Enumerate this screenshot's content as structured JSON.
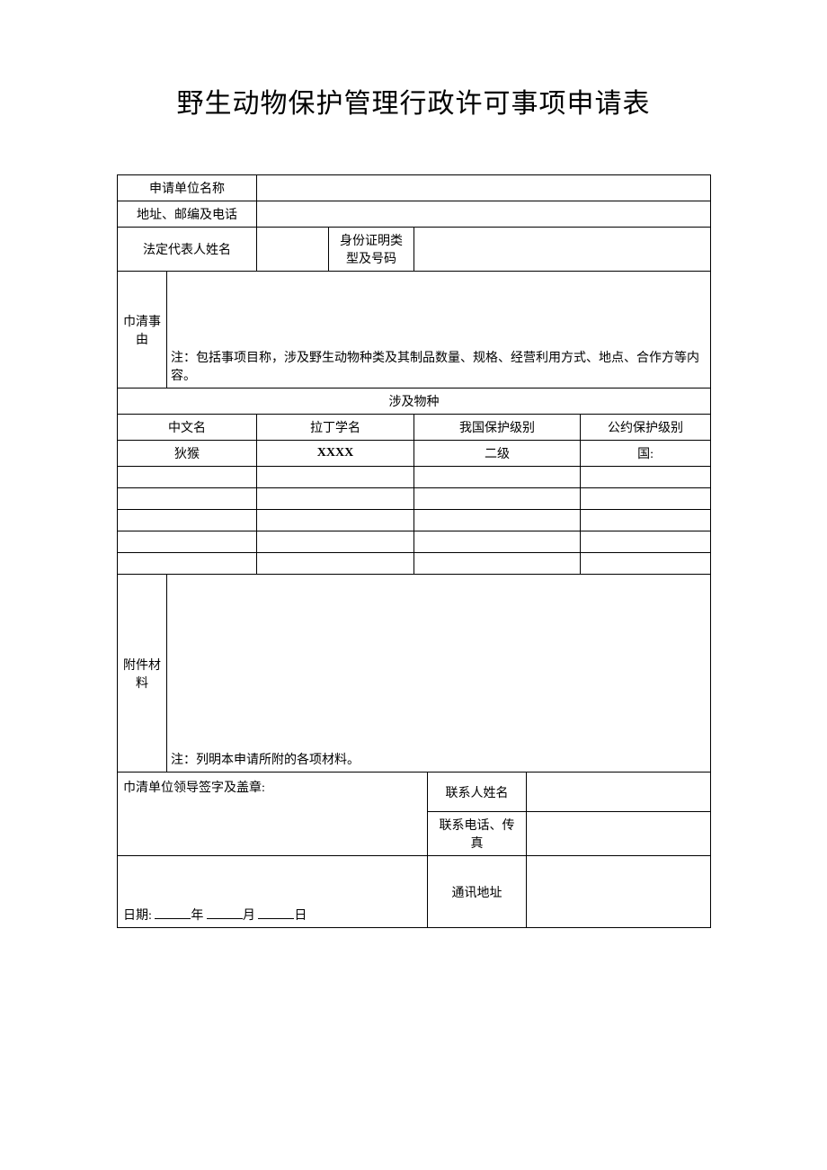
{
  "title": "野生动物保护管理行政许可事项申请表",
  "labels": {
    "applicant_unit": "申请单位名称",
    "address_zip_phone": "地址、邮编及电话",
    "legal_rep": "法定代表人姓名",
    "id_type_number": "身份证明类型及号码",
    "reason_label": "巾清事由",
    "reason_note": "注：包括事项目称，涉及野生动物种类及其制品数量、规格、经营利用方式、地点、合作方等内容。",
    "species_involved": "涉及物种",
    "chinese_name": "中文名",
    "latin_name": "拉丁学名",
    "cn_protection": "我国保护级别",
    "convention_protection": "公约保护级别",
    "attach_label": "附件材料",
    "attach_note": "注：列明本申请所附的各项材料。",
    "sign_text": "巾清单位领导签字及盖章:",
    "date_prefix": "日期:",
    "year": "年",
    "month": "月",
    "day": "日",
    "contact_name": "联系人姓名",
    "contact_phone": "联系电话、传真",
    "contact_address": "通讯地址"
  },
  "values": {
    "applicant_unit": "",
    "address_zip_phone": "",
    "legal_rep": "",
    "id_type_number": "",
    "contact_name": "",
    "contact_phone": "",
    "contact_address": ""
  },
  "species_rows": [
    {
      "cn": "狄猴",
      "latin": "XXXX",
      "cn_level": "二级",
      "conv_level": "国:"
    },
    {
      "cn": "",
      "latin": "",
      "cn_level": "",
      "conv_level": ""
    },
    {
      "cn": "",
      "latin": "",
      "cn_level": "",
      "conv_level": ""
    },
    {
      "cn": "",
      "latin": "",
      "cn_level": "",
      "conv_level": ""
    },
    {
      "cn": "",
      "latin": "",
      "cn_level": "",
      "conv_level": ""
    },
    {
      "cn": "",
      "latin": "",
      "cn_level": "",
      "conv_level": ""
    }
  ]
}
